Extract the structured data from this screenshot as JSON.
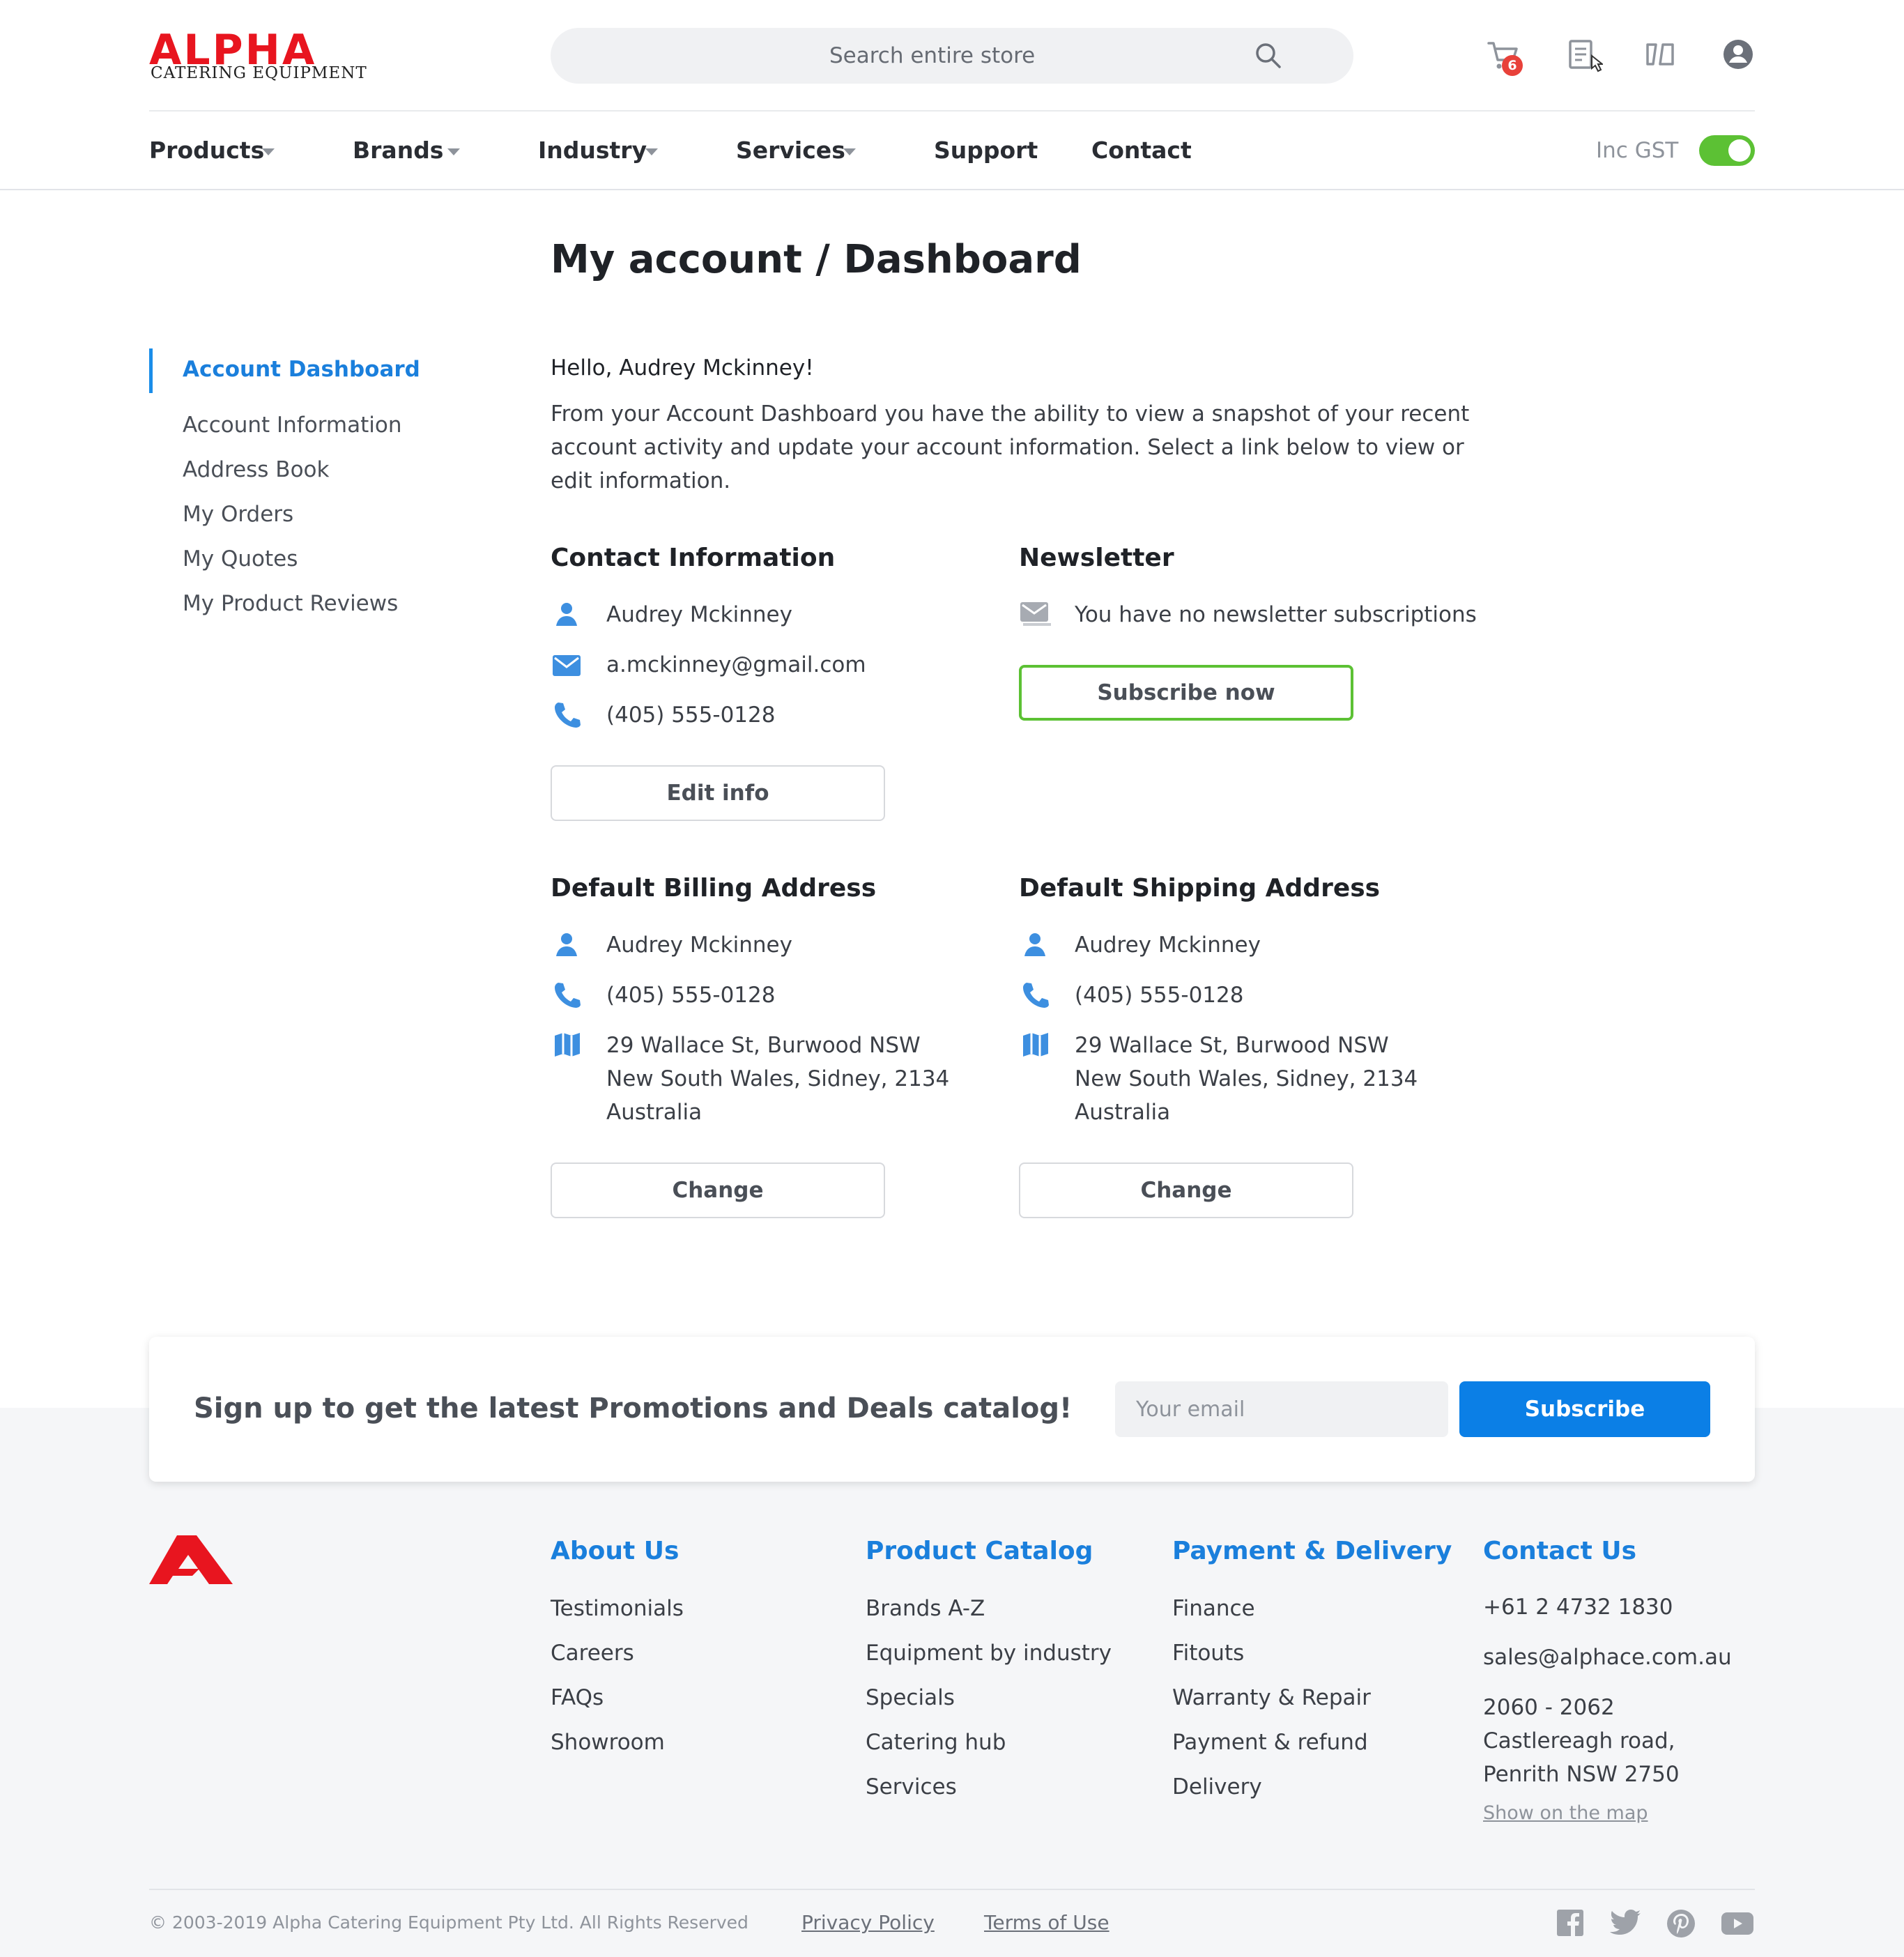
{
  "header": {
    "logo_word": "ALPHA",
    "logo_sub": "CATERING EQUIPMENT",
    "search_placeholder": "Search entire store",
    "cart_count": "6",
    "icons": [
      "cart-icon",
      "quote-list-icon",
      "compare-icon",
      "account-icon"
    ]
  },
  "nav": {
    "items": [
      {
        "label": "Products",
        "dropdown": true
      },
      {
        "label": "Brands",
        "dropdown": true
      },
      {
        "label": "Industry",
        "dropdown": true
      },
      {
        "label": "Services",
        "dropdown": true
      },
      {
        "label": "Support",
        "dropdown": false
      },
      {
        "label": "Contact",
        "dropdown": false
      }
    ],
    "gst_label": "Inc GST",
    "gst_enabled": true
  },
  "page": {
    "title": "My account / Dashboard"
  },
  "sidebar": {
    "items": [
      {
        "label": "Account Dashboard",
        "active": true
      },
      {
        "label": "Account Information",
        "active": false
      },
      {
        "label": "Address Book",
        "active": false
      },
      {
        "label": "My Orders",
        "active": false
      },
      {
        "label": "My Quotes",
        "active": false
      },
      {
        "label": "My Product Reviews",
        "active": false
      }
    ]
  },
  "dashboard": {
    "greeting": "Hello, Audrey Mckinney!",
    "intro": "From your Account Dashboard you have the ability to view a snapshot of your recent account activity and update your account information. Select a link below to view or edit information.",
    "contact": {
      "title": "Contact Information",
      "name": "Audrey Mckinney",
      "email": "a.mckinney@gmail.com",
      "phone": "(405) 555-0128",
      "button": "Edit info"
    },
    "newsletter": {
      "title": "Newsletter",
      "status": "You have no newsletter subscriptions",
      "button": "Subscribe now"
    },
    "billing": {
      "title": "Default Billing Address",
      "name": "Audrey Mckinney",
      "phone": "(405) 555-0128",
      "address_line1": "29 Wallace St, Burwood NSW",
      "address_line2": "New South Wales, Sidney, 2134",
      "address_line3": "Australia",
      "button": "Change"
    },
    "shipping": {
      "title": "Default Shipping Address",
      "name": "Audrey Mckinney",
      "phone": "(405) 555-0128",
      "address_line1": "29 Wallace St, Burwood NSW",
      "address_line2": "New South Wales, Sidney, 2134",
      "address_line3": "Australia",
      "button": "Change"
    }
  },
  "promo": {
    "text": "Sign up to get the latest Promotions and Deals catalog!",
    "email_placeholder": "Your email",
    "button": "Subscribe"
  },
  "footer": {
    "about": {
      "title": "About Us",
      "links": [
        "Testimonials",
        "Careers",
        "FAQs",
        "Showroom"
      ]
    },
    "catalog": {
      "title": "Product Catalog",
      "links": [
        "Brands A-Z",
        "Equipment by industry",
        "Specials",
        "Catering hub",
        "Services"
      ]
    },
    "payment": {
      "title": "Payment & Delivery",
      "links": [
        "Finance",
        "Fitouts",
        "Warranty & Repair",
        "Payment & refund",
        "Delivery"
      ]
    },
    "contact": {
      "title": "Contact Us",
      "phone": "+61 2 4732 1830",
      "email": "sales@alphace.com.au",
      "address_line1": "2060 - 2062",
      "address_line2": "Castlereagh road,",
      "address_line3": "Penrith NSW 2750",
      "map_link": "Show on the map"
    },
    "copyright": "© 2003-2019 Alpha Catering Equipment Pty Ltd. All Rights Reserved",
    "privacy": "Privacy Policy",
    "terms": "Terms of Use",
    "social": [
      "facebook-icon",
      "twitter-icon",
      "pinterest-icon",
      "youtube-icon"
    ]
  },
  "colors": {
    "brand_red": "#e8151f",
    "link_blue": "#1a7fdc",
    "accent_green": "#5cc134",
    "button_blue": "#0b7fe6",
    "icon_blue": "#3d8fe0"
  }
}
